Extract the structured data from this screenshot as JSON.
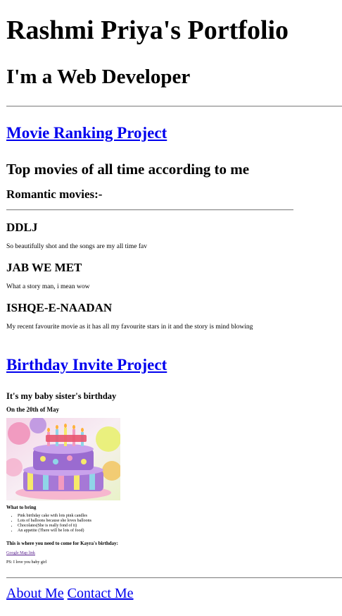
{
  "header": {
    "title": "Rashmi Priya's Portfolio",
    "subtitle": "I'm a Web Developer"
  },
  "projects": {
    "movie_link": "Movie Ranking Project",
    "birthday_link": "Birthday Invite Project"
  },
  "movies": {
    "heading": "Top movies of all time according to me",
    "category": "Romantic movies:-",
    "items": [
      {
        "title": "DDLJ",
        "desc": "So beautifully shot and the songs are my all time fav"
      },
      {
        "title": "JAB WE MET",
        "desc": "What a story man, i mean wow"
      },
      {
        "title": "ISHQE-E-NAADAN",
        "desc": "My recent favourite movie as it has all my favourite stars in it and the story is mind blowing"
      }
    ]
  },
  "birthday": {
    "heading": "It's my baby sister's birthday",
    "date": "On the 20th of May",
    "cake_alt": "birthday-cake-image",
    "bring_heading": "What to bring",
    "bring_items": [
      "Pink birthday cake with lots pink candles",
      "Lots of balloons because she loves balloons",
      "Chocolates(She is really fond of it)",
      "An appetite (There will be lots of food)"
    ],
    "where_heading": "This is where you need to come for Kayra's birthday:",
    "map_link": "Google Map link",
    "ps": "PS: I love you baby girl"
  },
  "footer": {
    "about": "About Me",
    "contact": "Contact Me"
  },
  "colors": {
    "link": "#0000ee",
    "visited_link": "#551a8b",
    "rule": "#8c8c8c"
  }
}
